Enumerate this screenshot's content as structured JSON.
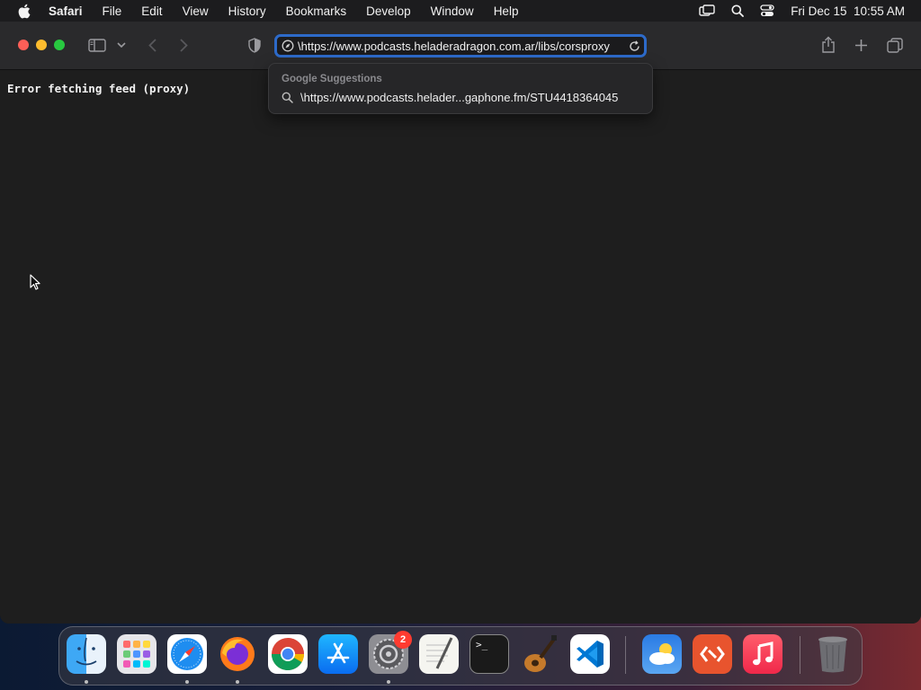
{
  "menubar": {
    "app_name": "Safari",
    "items": [
      "File",
      "Edit",
      "View",
      "History",
      "Bookmarks",
      "Develop",
      "Window",
      "Help"
    ],
    "clock": "Fri Dec 15  10:55 AM"
  },
  "toolbar": {
    "url": "\\https://www.podcasts.heladeradragon.com.ar/libs/corsproxy"
  },
  "suggestions": {
    "header": "Google Suggestions",
    "items": [
      "\\https://www.podcasts.helader...gaphone.fm/STU4418364045"
    ]
  },
  "page": {
    "message": "Error fetching feed (proxy)"
  },
  "dock": {
    "system_settings_badge": "2",
    "terminal_prompt": ">_"
  },
  "colors": {
    "accent": "#2d6ac9",
    "close": "#fe5f57",
    "minimize": "#febc2e",
    "maximize": "#28c840",
    "badge": "#ff3b30"
  }
}
